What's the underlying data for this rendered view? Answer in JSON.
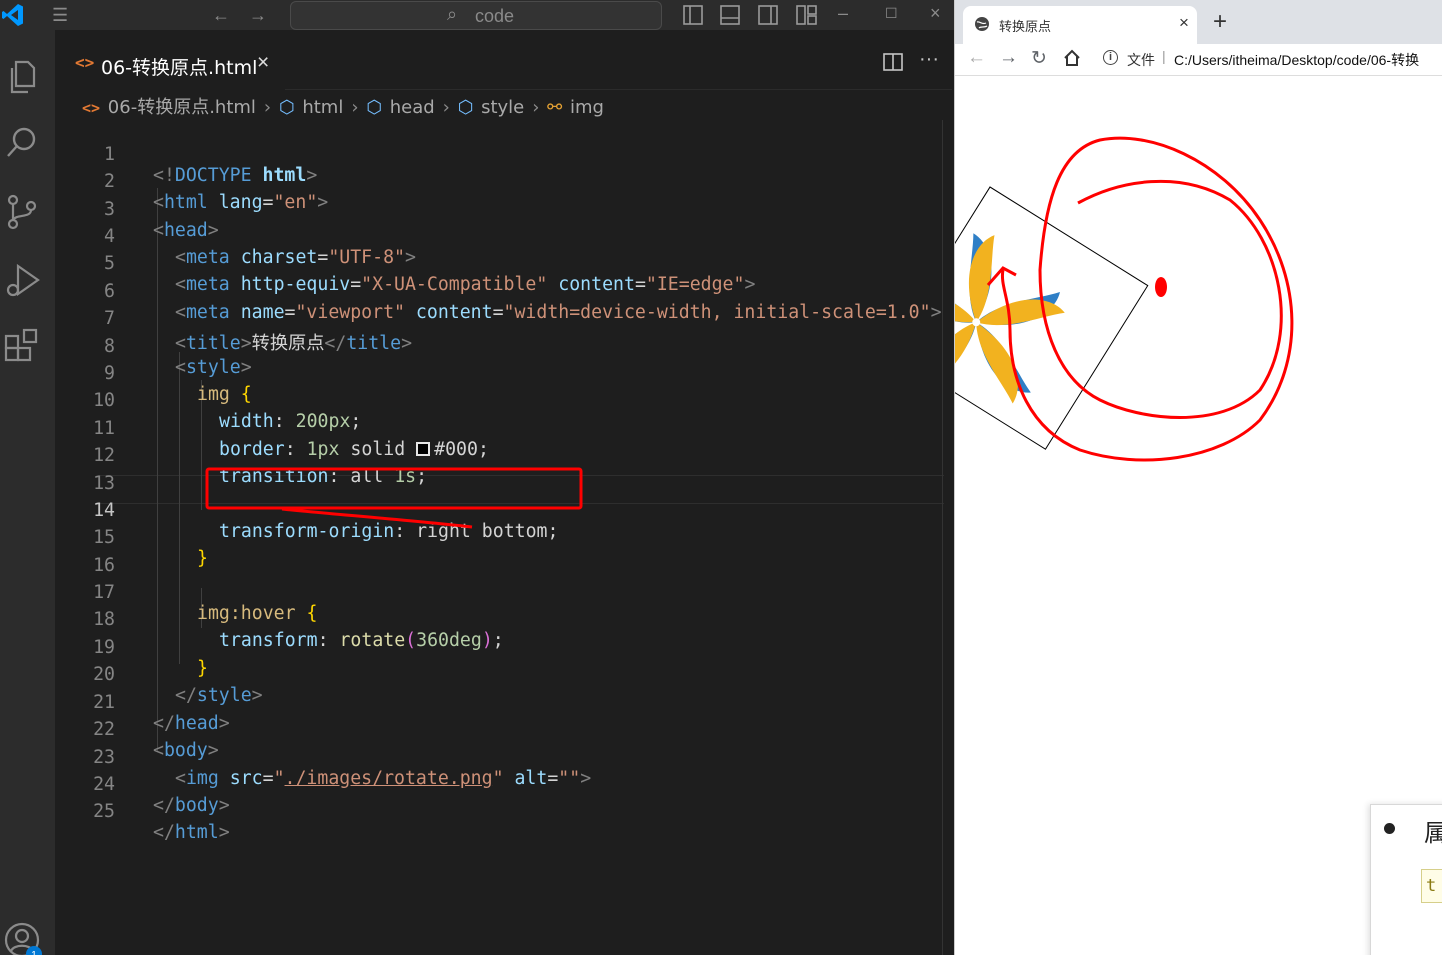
{
  "vscode": {
    "command_center": {
      "label": "code"
    },
    "tab": {
      "filename": "06-转换原点.html",
      "close_glyph": "×"
    },
    "breadcrumb": [
      "06-转换原点.html",
      "html",
      "head",
      "style",
      "img"
    ],
    "lines": [
      {
        "n": "1"
      },
      {
        "n": "2"
      },
      {
        "n": "3"
      },
      {
        "n": "4"
      },
      {
        "n": "5"
      },
      {
        "n": "6"
      },
      {
        "n": "7"
      },
      {
        "n": "8"
      },
      {
        "n": "9"
      },
      {
        "n": "10"
      },
      {
        "n": "11"
      },
      {
        "n": "12"
      },
      {
        "n": "13"
      },
      {
        "n": "14"
      },
      {
        "n": "15"
      },
      {
        "n": "16"
      },
      {
        "n": "17"
      },
      {
        "n": "18"
      },
      {
        "n": "19"
      },
      {
        "n": "20"
      },
      {
        "n": "21"
      },
      {
        "n": "22"
      },
      {
        "n": "23"
      },
      {
        "n": "24"
      },
      {
        "n": "25"
      }
    ],
    "code": {
      "l1": {
        "a": "<!",
        "b": "DOCTYPE",
        "c": " html",
        "d": ">"
      },
      "l2": {
        "a": "<",
        "b": "html",
        "c": " lang",
        "d": "=",
        "e": "\"en\"",
        "f": ">"
      },
      "l3": {
        "a": "<",
        "b": "head",
        "c": ">"
      },
      "l4": {
        "a": "<",
        "b": "meta",
        "c": " charset",
        "d": "=",
        "e": "\"UTF-8\"",
        "f": ">"
      },
      "l5": {
        "a": "<",
        "b": "meta",
        "c": " http-equiv",
        "d": "=",
        "e": "\"X-UA-Compatible\"",
        "f": " content",
        "g": "=",
        "h": "\"IE=edge\"",
        "i": ">"
      },
      "l6": {
        "a": "<",
        "b": "meta",
        "c": " name",
        "d": "=",
        "e": "\"viewport\"",
        "f": " content",
        "g": "=",
        "h": "\"width=device-width, initial-scale=1.0\"",
        "i": ">"
      },
      "l7": {
        "a": "<",
        "b": "title",
        "c": ">",
        "d": "转换原点",
        "e": "</",
        "f": "title",
        "g": ">"
      },
      "l8": {
        "a": "<",
        "b": "style",
        "c": ">"
      },
      "l9": {
        "a": "img",
        "b": " {"
      },
      "l10": {
        "a": "width",
        "b": ": ",
        "c": "200px",
        "d": ";"
      },
      "l11": {
        "a": "border",
        "b": ": ",
        "c": "1px",
        "d": " solid ",
        "e": "#000",
        "f": ";"
      },
      "l12": {
        "a": "transition",
        "b": ": all ",
        "c": "1s",
        "d": ";"
      },
      "l14": {
        "a": "transform-origin",
        "b": ": right bottom;"
      },
      "l15": {
        "a": "}"
      },
      "l17": {
        "a": "img:hover",
        "b": " {"
      },
      "l18": {
        "a": "transform",
        "b": ": ",
        "c": "rotate",
        "d": "(",
        "e": "360deg",
        "f": ")",
        "g": ";"
      },
      "l19": {
        "a": "}"
      },
      "l20": {
        "a": "</",
        "b": "style",
        "c": ">"
      },
      "l21": {
        "a": "</",
        "b": "head",
        "c": ">"
      },
      "l22": {
        "a": "<",
        "b": "body",
        "c": ">"
      },
      "l23": {
        "a": "<",
        "b": "img",
        "c": " src",
        "d": "=",
        "e": "\"",
        "f": "./images/rotate.png",
        "g": "\"",
        "h": " alt",
        "i": "=",
        "j": "\"\"",
        "k": ">"
      },
      "l24": {
        "a": "</",
        "b": "body",
        "c": ">"
      },
      "l25": {
        "a": "</",
        "b": "html",
        "c": ">"
      }
    }
  },
  "browser": {
    "tab_title": "转换原点",
    "close_glyph": "×",
    "new_tab_glyph": "+",
    "address": {
      "scheme_label": "文件",
      "url": "C:/Users/itheima/Desktop/code/06-转换"
    },
    "popup": {
      "char": "属",
      "code_char": "t"
    }
  },
  "colors": {
    "accent": "#0098ff",
    "annotation": "#ff0000",
    "pinwheel_blue": "#2f7fc6",
    "pinwheel_gold": "#f2b21f"
  },
  "icons": [
    "vscode-logo-icon",
    "menu-icon",
    "back-arrow-icon",
    "forward-arrow-icon",
    "search-icon",
    "layout-icon",
    "explorer-icon",
    "source-control-icon",
    "run-debug-icon",
    "extensions-icon",
    "account-icon",
    "split-editor-icon",
    "more-icon",
    "globe-icon",
    "reload-icon",
    "home-icon",
    "info-icon"
  ]
}
